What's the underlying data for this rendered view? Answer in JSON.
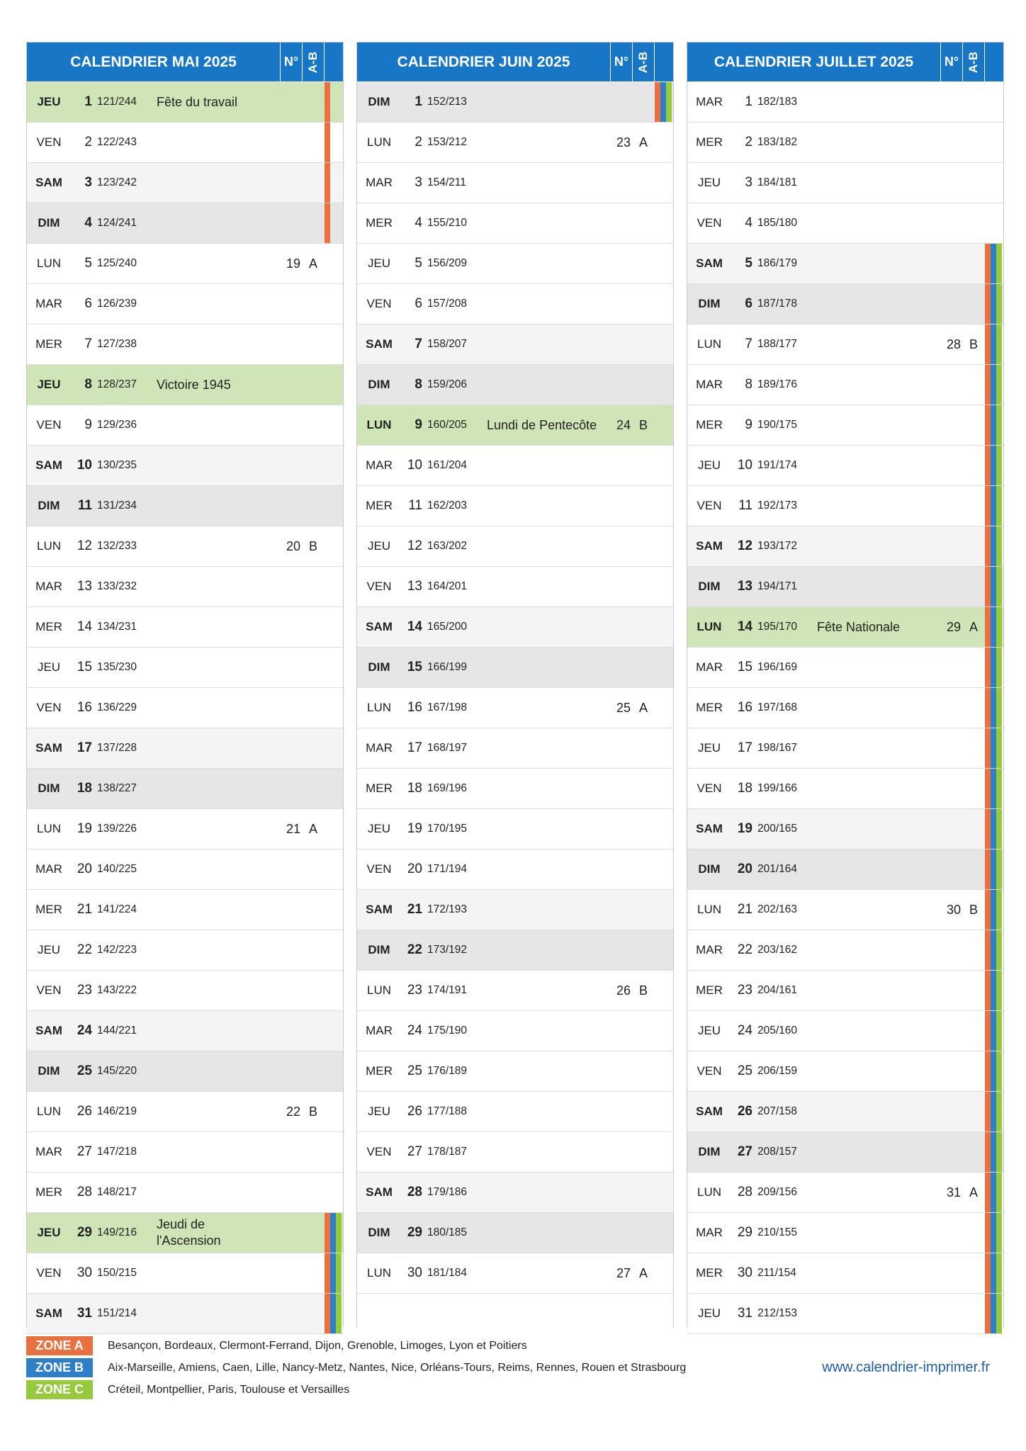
{
  "headers": {
    "num": "N°",
    "ab": "A-B"
  },
  "colors": {
    "header": "#1776c6",
    "zoneA": "#ea7040",
    "zoneB": "#2f7fc8",
    "zoneC": "#97c93d",
    "holiday": "#cfe4b7",
    "saturday": "#f4f4f4",
    "sunday": "#e6e6e6"
  },
  "months": [
    {
      "title": "CALENDRIER MAI 2025",
      "days": [
        {
          "wd": "JEU",
          "d": "1",
          "dy": "121/244",
          "ev": "Fête du travail",
          "kind": "hol",
          "zones": [
            "A"
          ]
        },
        {
          "wd": "VEN",
          "d": "2",
          "dy": "122/243",
          "zones": [
            "A"
          ]
        },
        {
          "wd": "SAM",
          "d": "3",
          "dy": "123/242",
          "kind": "sat",
          "zones": [
            "A"
          ]
        },
        {
          "wd": "DIM",
          "d": "4",
          "dy": "124/241",
          "kind": "sun",
          "zones": [
            "A"
          ]
        },
        {
          "wd": "LUN",
          "d": "5",
          "dy": "125/240",
          "wk": "19",
          "ab": "A"
        },
        {
          "wd": "MAR",
          "d": "6",
          "dy": "126/239"
        },
        {
          "wd": "MER",
          "d": "7",
          "dy": "127/238"
        },
        {
          "wd": "JEU",
          "d": "8",
          "dy": "128/237",
          "ev": "Victoire 1945",
          "kind": "hol"
        },
        {
          "wd": "VEN",
          "d": "9",
          "dy": "129/236"
        },
        {
          "wd": "SAM",
          "d": "10",
          "dy": "130/235",
          "kind": "sat"
        },
        {
          "wd": "DIM",
          "d": "11",
          "dy": "131/234",
          "kind": "sun"
        },
        {
          "wd": "LUN",
          "d": "12",
          "dy": "132/233",
          "wk": "20",
          "ab": "B"
        },
        {
          "wd": "MAR",
          "d": "13",
          "dy": "133/232"
        },
        {
          "wd": "MER",
          "d": "14",
          "dy": "134/231"
        },
        {
          "wd": "JEU",
          "d": "15",
          "dy": "135/230"
        },
        {
          "wd": "VEN",
          "d": "16",
          "dy": "136/229"
        },
        {
          "wd": "SAM",
          "d": "17",
          "dy": "137/228",
          "kind": "sat"
        },
        {
          "wd": "DIM",
          "d": "18",
          "dy": "138/227",
          "kind": "sun"
        },
        {
          "wd": "LUN",
          "d": "19",
          "dy": "139/226",
          "wk": "21",
          "ab": "A"
        },
        {
          "wd": "MAR",
          "d": "20",
          "dy": "140/225"
        },
        {
          "wd": "MER",
          "d": "21",
          "dy": "141/224"
        },
        {
          "wd": "JEU",
          "d": "22",
          "dy": "142/223"
        },
        {
          "wd": "VEN",
          "d": "23",
          "dy": "143/222"
        },
        {
          "wd": "SAM",
          "d": "24",
          "dy": "144/221",
          "kind": "sat"
        },
        {
          "wd": "DIM",
          "d": "25",
          "dy": "145/220",
          "kind": "sun"
        },
        {
          "wd": "LUN",
          "d": "26",
          "dy": "146/219",
          "wk": "22",
          "ab": "B"
        },
        {
          "wd": "MAR",
          "d": "27",
          "dy": "147/218"
        },
        {
          "wd": "MER",
          "d": "28",
          "dy": "148/217"
        },
        {
          "wd": "JEU",
          "d": "29",
          "dy": "149/216",
          "ev": "Jeudi de l'Ascension",
          "kind": "hol",
          "zones": [
            "A",
            "B",
            "C"
          ]
        },
        {
          "wd": "VEN",
          "d": "30",
          "dy": "150/215",
          "zones": [
            "A",
            "B",
            "C"
          ]
        },
        {
          "wd": "SAM",
          "d": "31",
          "dy": "151/214",
          "kind": "sat",
          "zones": [
            "A",
            "B",
            "C"
          ]
        }
      ]
    },
    {
      "title": "CALENDRIER JUIN 2025",
      "days": [
        {
          "wd": "DIM",
          "d": "1",
          "dy": "152/213",
          "kind": "sun",
          "zones": [
            "A",
            "B",
            "C"
          ]
        },
        {
          "wd": "LUN",
          "d": "2",
          "dy": "153/212",
          "wk": "23",
          "ab": "A"
        },
        {
          "wd": "MAR",
          "d": "3",
          "dy": "154/211"
        },
        {
          "wd": "MER",
          "d": "4",
          "dy": "155/210"
        },
        {
          "wd": "JEU",
          "d": "5",
          "dy": "156/209"
        },
        {
          "wd": "VEN",
          "d": "6",
          "dy": "157/208"
        },
        {
          "wd": "SAM",
          "d": "7",
          "dy": "158/207",
          "kind": "sat"
        },
        {
          "wd": "DIM",
          "d": "8",
          "dy": "159/206",
          "kind": "sun"
        },
        {
          "wd": "LUN",
          "d": "9",
          "dy": "160/205",
          "ev": "Lundi de Pentecôte",
          "kind": "hol",
          "wk": "24",
          "ab": "B"
        },
        {
          "wd": "MAR",
          "d": "10",
          "dy": "161/204"
        },
        {
          "wd": "MER",
          "d": "11",
          "dy": "162/203"
        },
        {
          "wd": "JEU",
          "d": "12",
          "dy": "163/202"
        },
        {
          "wd": "VEN",
          "d": "13",
          "dy": "164/201"
        },
        {
          "wd": "SAM",
          "d": "14",
          "dy": "165/200",
          "kind": "sat"
        },
        {
          "wd": "DIM",
          "d": "15",
          "dy": "166/199",
          "kind": "sun"
        },
        {
          "wd": "LUN",
          "d": "16",
          "dy": "167/198",
          "wk": "25",
          "ab": "A"
        },
        {
          "wd": "MAR",
          "d": "17",
          "dy": "168/197"
        },
        {
          "wd": "MER",
          "d": "18",
          "dy": "169/196"
        },
        {
          "wd": "JEU",
          "d": "19",
          "dy": "170/195"
        },
        {
          "wd": "VEN",
          "d": "20",
          "dy": "171/194"
        },
        {
          "wd": "SAM",
          "d": "21",
          "dy": "172/193",
          "kind": "sat"
        },
        {
          "wd": "DIM",
          "d": "22",
          "dy": "173/192",
          "kind": "sun"
        },
        {
          "wd": "LUN",
          "d": "23",
          "dy": "174/191",
          "wk": "26",
          "ab": "B"
        },
        {
          "wd": "MAR",
          "d": "24",
          "dy": "175/190"
        },
        {
          "wd": "MER",
          "d": "25",
          "dy": "176/189"
        },
        {
          "wd": "JEU",
          "d": "26",
          "dy": "177/188"
        },
        {
          "wd": "VEN",
          "d": "27",
          "dy": "178/187"
        },
        {
          "wd": "SAM",
          "d": "28",
          "dy": "179/186",
          "kind": "sat"
        },
        {
          "wd": "DIM",
          "d": "29",
          "dy": "180/185",
          "kind": "sun"
        },
        {
          "wd": "LUN",
          "d": "30",
          "dy": "181/184",
          "wk": "27",
          "ab": "A"
        }
      ]
    },
    {
      "title": "CALENDRIER JUILLET 2025",
      "days": [
        {
          "wd": "MAR",
          "d": "1",
          "dy": "182/183"
        },
        {
          "wd": "MER",
          "d": "2",
          "dy": "183/182"
        },
        {
          "wd": "JEU",
          "d": "3",
          "dy": "184/181"
        },
        {
          "wd": "VEN",
          "d": "4",
          "dy": "185/180"
        },
        {
          "wd": "SAM",
          "d": "5",
          "dy": "186/179",
          "kind": "sat",
          "zones": [
            "A",
            "B",
            "C"
          ]
        },
        {
          "wd": "DIM",
          "d": "6",
          "dy": "187/178",
          "kind": "sun",
          "zones": [
            "A",
            "B",
            "C"
          ]
        },
        {
          "wd": "LUN",
          "d": "7",
          "dy": "188/177",
          "wk": "28",
          "ab": "B",
          "zones": [
            "A",
            "B",
            "C"
          ]
        },
        {
          "wd": "MAR",
          "d": "8",
          "dy": "189/176",
          "zones": [
            "A",
            "B",
            "C"
          ]
        },
        {
          "wd": "MER",
          "d": "9",
          "dy": "190/175",
          "zones": [
            "A",
            "B",
            "C"
          ]
        },
        {
          "wd": "JEU",
          "d": "10",
          "dy": "191/174",
          "zones": [
            "A",
            "B",
            "C"
          ]
        },
        {
          "wd": "VEN",
          "d": "11",
          "dy": "192/173",
          "zones": [
            "A",
            "B",
            "C"
          ]
        },
        {
          "wd": "SAM",
          "d": "12",
          "dy": "193/172",
          "kind": "sat",
          "zones": [
            "A",
            "B",
            "C"
          ]
        },
        {
          "wd": "DIM",
          "d": "13",
          "dy": "194/171",
          "kind": "sun",
          "zones": [
            "A",
            "B",
            "C"
          ]
        },
        {
          "wd": "LUN",
          "d": "14",
          "dy": "195/170",
          "ev": "Fête Nationale",
          "kind": "hol",
          "wk": "29",
          "ab": "A",
          "zones": [
            "A",
            "B",
            "C"
          ]
        },
        {
          "wd": "MAR",
          "d": "15",
          "dy": "196/169",
          "zones": [
            "A",
            "B",
            "C"
          ]
        },
        {
          "wd": "MER",
          "d": "16",
          "dy": "197/168",
          "zones": [
            "A",
            "B",
            "C"
          ]
        },
        {
          "wd": "JEU",
          "d": "17",
          "dy": "198/167",
          "zones": [
            "A",
            "B",
            "C"
          ]
        },
        {
          "wd": "VEN",
          "d": "18",
          "dy": "199/166",
          "zones": [
            "A",
            "B",
            "C"
          ]
        },
        {
          "wd": "SAM",
          "d": "19",
          "dy": "200/165",
          "kind": "sat",
          "zones": [
            "A",
            "B",
            "C"
          ]
        },
        {
          "wd": "DIM",
          "d": "20",
          "dy": "201/164",
          "kind": "sun",
          "zones": [
            "A",
            "B",
            "C"
          ]
        },
        {
          "wd": "LUN",
          "d": "21",
          "dy": "202/163",
          "wk": "30",
          "ab": "B",
          "zones": [
            "A",
            "B",
            "C"
          ]
        },
        {
          "wd": "MAR",
          "d": "22",
          "dy": "203/162",
          "zones": [
            "A",
            "B",
            "C"
          ]
        },
        {
          "wd": "MER",
          "d": "23",
          "dy": "204/161",
          "zones": [
            "A",
            "B",
            "C"
          ]
        },
        {
          "wd": "JEU",
          "d": "24",
          "dy": "205/160",
          "zones": [
            "A",
            "B",
            "C"
          ]
        },
        {
          "wd": "VEN",
          "d": "25",
          "dy": "206/159",
          "zones": [
            "A",
            "B",
            "C"
          ]
        },
        {
          "wd": "SAM",
          "d": "26",
          "dy": "207/158",
          "kind": "sat",
          "zones": [
            "A",
            "B",
            "C"
          ]
        },
        {
          "wd": "DIM",
          "d": "27",
          "dy": "208/157",
          "kind": "sun",
          "zones": [
            "A",
            "B",
            "C"
          ]
        },
        {
          "wd": "LUN",
          "d": "28",
          "dy": "209/156",
          "wk": "31",
          "ab": "A",
          "zones": [
            "A",
            "B",
            "C"
          ]
        },
        {
          "wd": "MAR",
          "d": "29",
          "dy": "210/155",
          "zones": [
            "A",
            "B",
            "C"
          ]
        },
        {
          "wd": "MER",
          "d": "30",
          "dy": "211/154",
          "zones": [
            "A",
            "B",
            "C"
          ]
        },
        {
          "wd": "JEU",
          "d": "31",
          "dy": "212/153",
          "zones": [
            "A",
            "B",
            "C"
          ]
        }
      ]
    }
  ],
  "legend": {
    "zones": [
      {
        "key": "A",
        "label": "ZONE A",
        "cities": "Besançon, Bordeaux, Clermont-Ferrand, Dijon, Grenoble, Limoges, Lyon et Poitiers"
      },
      {
        "key": "B",
        "label": "ZONE B",
        "cities": "Aix-Marseille, Amiens, Caen, Lille, Nancy-Metz, Nantes, Nice, Orléans-Tours, Reims, Rennes, Rouen et Strasbourg"
      },
      {
        "key": "C",
        "label": "ZONE C",
        "cities": "Créteil, Montpellier, Paris, Toulouse et Versailles"
      }
    ],
    "website": "www.calendrier-imprimer.fr"
  }
}
